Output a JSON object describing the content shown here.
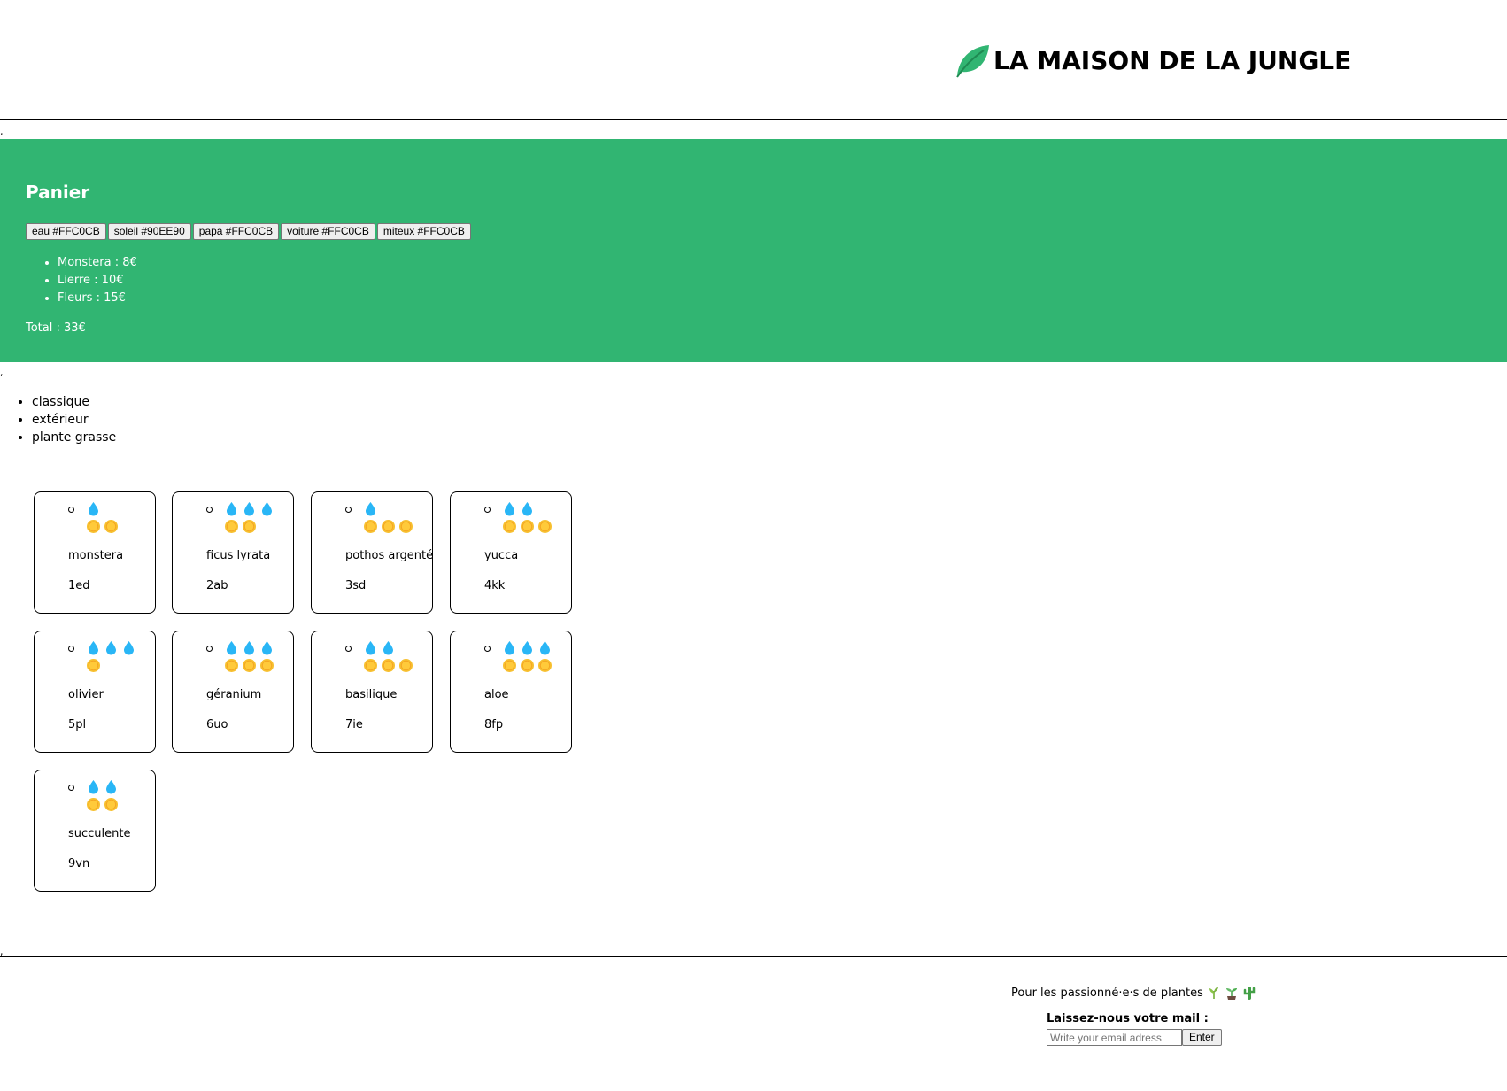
{
  "header": {
    "logo_icon": "leaf-icon",
    "title": "LA MAISON DE LA JUNGLE"
  },
  "separators": [
    ",",
    ",",
    ","
  ],
  "cart": {
    "title": "Panier",
    "background_color": "#31b572",
    "color_buttons": [
      {
        "label": "eau #FFC0CB"
      },
      {
        "label": "soleil #90EE90"
      },
      {
        "label": "papa #FFC0CB"
      },
      {
        "label": "voiture #FFC0CB"
      },
      {
        "label": "miteux #FFC0CB"
      }
    ],
    "items": [
      {
        "text": "Monstera : 8€"
      },
      {
        "text": "Lierre : 10€"
      },
      {
        "text": "Fleurs : 15€"
      }
    ],
    "total": "Total : 33€"
  },
  "categories": [
    "classique",
    "extérieur",
    "plante grasse"
  ],
  "plants": [
    {
      "name": "monstera",
      "id": "1ed",
      "water": 1,
      "light": 2
    },
    {
      "name": "ficus lyrata",
      "id": "2ab",
      "water": 3,
      "light": 2
    },
    {
      "name": "pothos argenté",
      "id": "3sd",
      "water": 1,
      "light": 3
    },
    {
      "name": "yucca",
      "id": "4kk",
      "water": 2,
      "light": 3
    },
    {
      "name": "olivier",
      "id": "5pl",
      "water": 3,
      "light": 1
    },
    {
      "name": "géranium",
      "id": "6uo",
      "water": 3,
      "light": 3
    },
    {
      "name": "basilique",
      "id": "7ie",
      "water": 2,
      "light": 3
    },
    {
      "name": "aloe",
      "id": "8fp",
      "water": 3,
      "light": 3
    },
    {
      "name": "succulente",
      "id": "9vn",
      "water": 2,
      "light": 2
    }
  ],
  "footer": {
    "tagline": "Pour les passionné·e·s de plantes",
    "tagline_icons": [
      "herb-icon",
      "seedling-icon",
      "cactus-icon"
    ],
    "mail_label": "Laissez-nous votre mail :",
    "mail_placeholder": "Write your email adress",
    "submit_label": "Enter"
  }
}
